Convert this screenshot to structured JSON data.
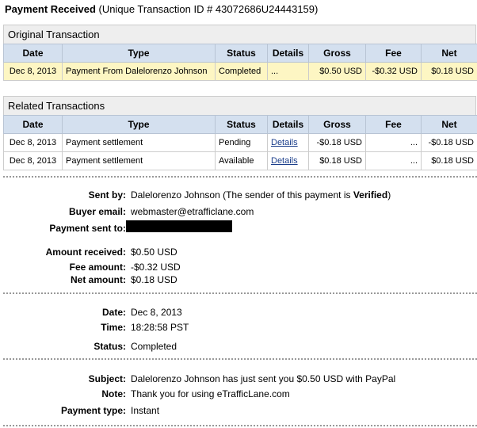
{
  "header": {
    "title": "Payment Received",
    "subtitle": "(Unique Transaction ID # 43072686U24443159)"
  },
  "original": {
    "title": "Original Transaction",
    "columns": [
      "Date",
      "Type",
      "Status",
      "Details",
      "Gross",
      "Fee",
      "Net"
    ],
    "row": {
      "date": "Dec 8, 2013",
      "type": "Payment From Dalelorenzo Johnson",
      "status": "Completed",
      "details": "...",
      "gross": "$0.50 USD",
      "fee": "-$0.32 USD",
      "net": "$0.18 USD"
    }
  },
  "related": {
    "title": "Related Transactions",
    "columns": [
      "Date",
      "Type",
      "Status",
      "Details",
      "Gross",
      "Fee",
      "Net"
    ],
    "rows": [
      {
        "date": "Dec 8, 2013",
        "type": "Payment settlement",
        "status": "Pending",
        "details": "Details",
        "gross": "-$0.18 USD",
        "fee": "...",
        "net": "-$0.18 USD"
      },
      {
        "date": "Dec 8, 2013",
        "type": "Payment settlement",
        "status": "Available",
        "details": "Details",
        "gross": "$0.18 USD",
        "fee": "...",
        "net": "$0.18 USD"
      }
    ]
  },
  "sender": {
    "sent_by_label": "Sent by:",
    "sent_by_value": "Dalelorenzo Johnson (The sender of this payment is ",
    "verified": "Verified",
    "sent_by_close": ")",
    "buyer_email_label": "Buyer email:",
    "buyer_email_value": "webmaster@etrafficlane.com",
    "payment_sent_to_label": "Payment sent to:"
  },
  "amounts": {
    "received_label": "Amount received:",
    "received_value": "$0.50 USD",
    "fee_label": "Fee amount:",
    "fee_value": "-$0.32 USD",
    "net_label": "Net amount:",
    "net_value": "$0.18 USD"
  },
  "timing": {
    "date_label": "Date:",
    "date_value": "Dec 8, 2013",
    "time_label": "Time:",
    "time_value": "18:28:58 PST",
    "status_label": "Status:",
    "status_value": "Completed"
  },
  "message": {
    "subject_label": "Subject:",
    "subject_value": "Dalelorenzo Johnson has just sent you $0.50 USD with PayPal",
    "note_label": "Note:",
    "note_value": "Thank you for using eTrafficLane.com",
    "payment_type_label": "Payment type:",
    "payment_type_value": "Instant"
  }
}
